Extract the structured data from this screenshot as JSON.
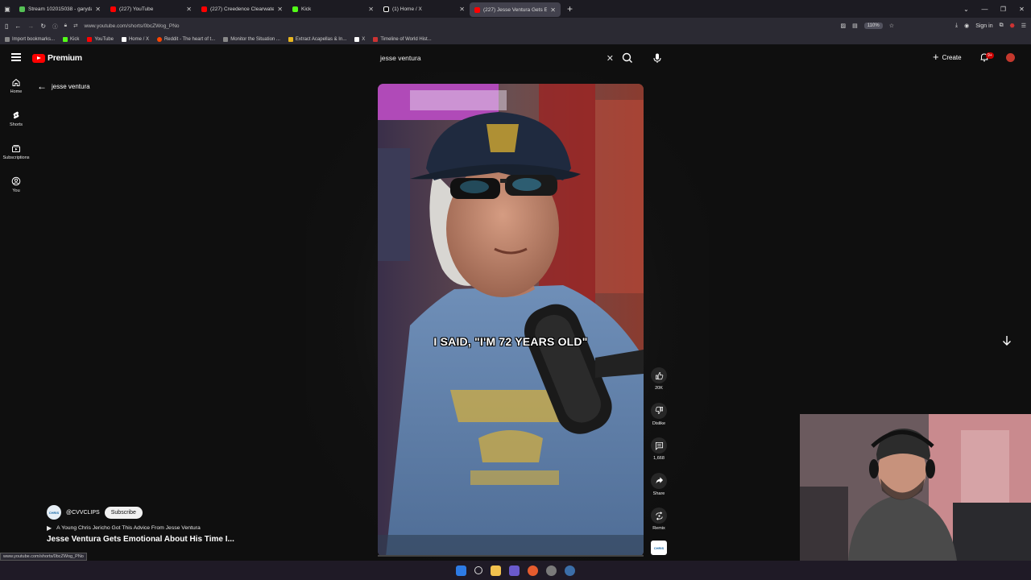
{
  "browser": {
    "tabs": [
      {
        "title": "Stream 102015038 - garydavid",
        "color": "#55c155",
        "active": false
      },
      {
        "title": "(227) YouTube",
        "color": "#ff0000",
        "active": false
      },
      {
        "title": "(227) Creedence Clearwater Re",
        "color": "#ff0000",
        "active": false
      },
      {
        "title": "Kick",
        "color": "#53fc18",
        "active": false
      },
      {
        "title": "(1) Home / X",
        "color": "#ffffff",
        "active": false
      },
      {
        "title": "(227) Jesse Ventura Gets Em",
        "color": "#ff0000",
        "active": true
      }
    ],
    "url": "www.youtube.com/shorts/0bcZWog_PNo",
    "zoom": "110%",
    "signin": "Sign in",
    "bookmarks": [
      "Import bookmarks...",
      "Kick",
      "YouTube",
      "Home / X",
      "Reddit - The heart of t...",
      "Monitor the Situation ...",
      "Extract Acapellas & In...",
      "X",
      "Timeline of World Hist..."
    ],
    "status_url": "www.youtube.com/shorts/0bcZWog_PNo"
  },
  "youtube": {
    "logo_text": "Premium",
    "search_value": "jesse ventura",
    "create_label": "Create",
    "notif_badge": "9+",
    "rail": [
      {
        "label": "Home",
        "icon": "home-icon"
      },
      {
        "label": "Shorts",
        "icon": "shorts-icon"
      },
      {
        "label": "Subscriptions",
        "icon": "subscriptions-icon"
      },
      {
        "label": "You",
        "icon": "you-icon"
      }
    ],
    "back_label": "jesse ventura"
  },
  "short": {
    "caption": "I SAID, \"I'M 72 YEARS OLD\"",
    "progress": 0.0,
    "likes": "20K",
    "dislike_label": "Dislike",
    "comments": "1,668",
    "share_label": "Share",
    "remix_label": "Remix",
    "channel": "@CVVCLIPS",
    "channel_badge": "CHRIS",
    "subscribe_label": "Subscribe",
    "related": "A Young Chris Jericho Got This Advice From Jesse Ventura",
    "title": "Jesse Ventura Gets Emotional About His Time I..."
  },
  "colors": {
    "accent": "#ff0000",
    "bg": "#0f0f0f"
  }
}
